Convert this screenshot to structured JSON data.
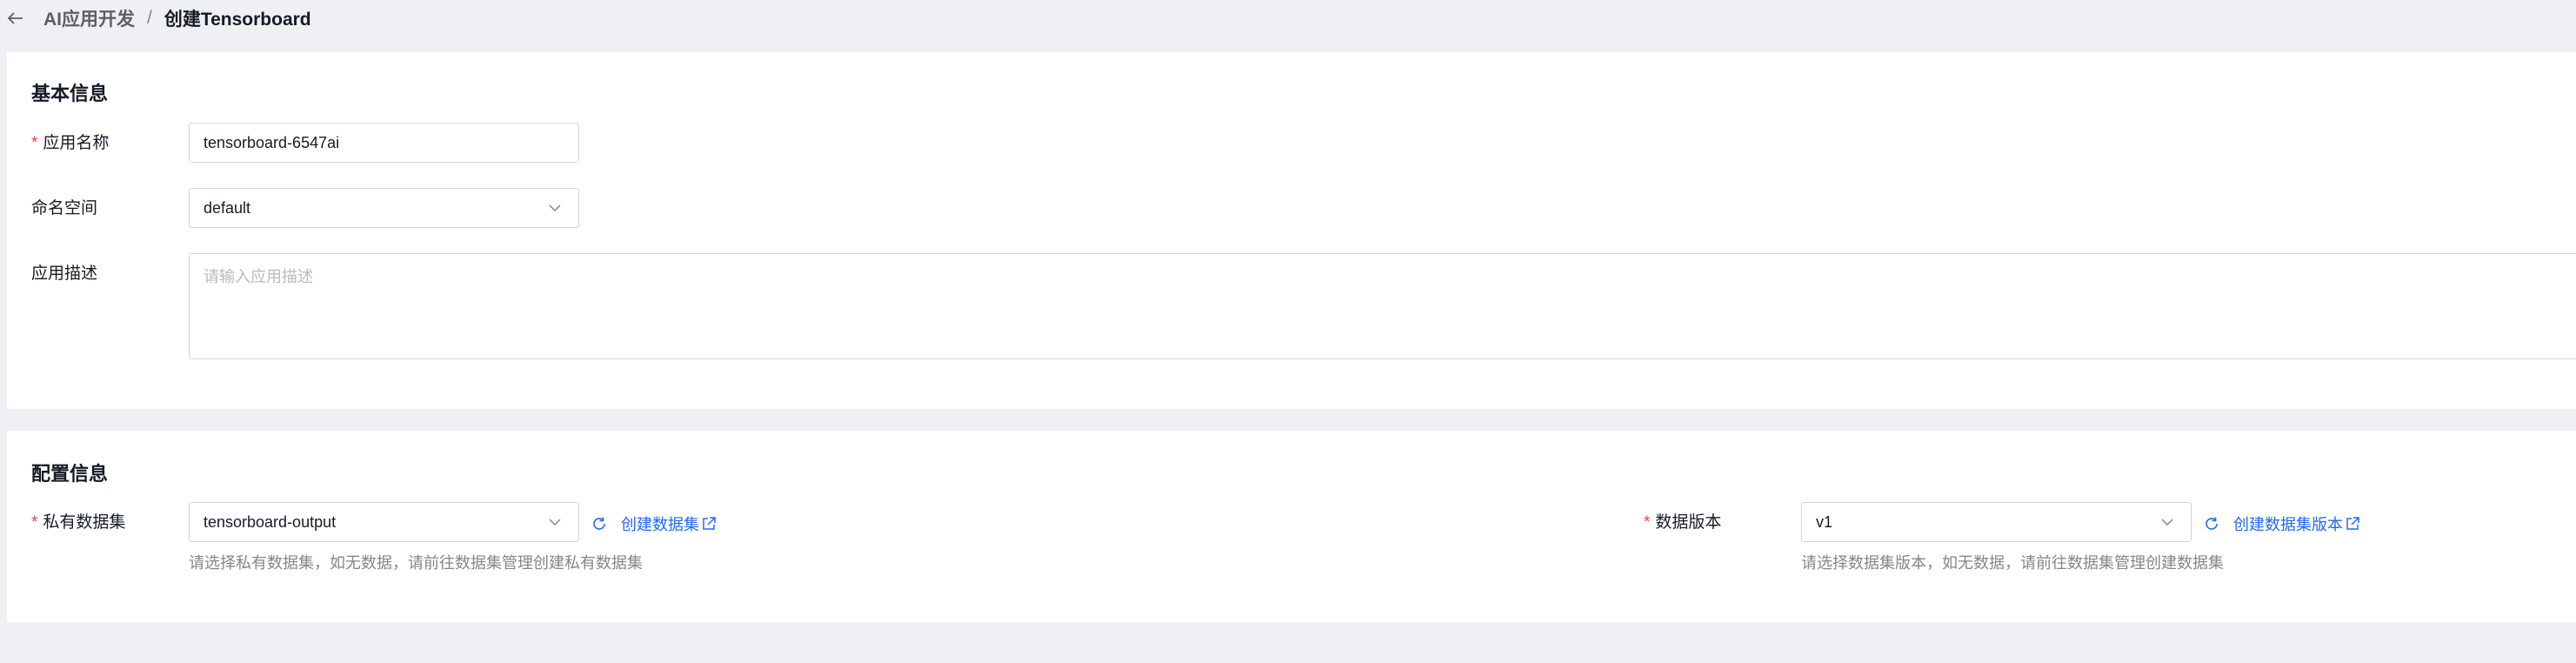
{
  "header": {
    "parent": "AI应用开发",
    "separator": "/",
    "current": "创建Tensorboard"
  },
  "basic": {
    "title": "基本信息",
    "app_name": {
      "required": "*",
      "label": "应用名称",
      "value": "tensorboard-6547ai"
    },
    "namespace": {
      "label": "命名空间",
      "value": "default"
    },
    "description": {
      "label": "应用描述",
      "placeholder": "请输入应用描述"
    }
  },
  "config": {
    "title": "配置信息",
    "dataset": {
      "required": "*",
      "label": "私有数据集",
      "value": "tensorboard-output",
      "link": "创建数据集",
      "hint": "请选择私有数据集，如无数据，请前往数据集管理创建私有数据集"
    },
    "version": {
      "required": "*",
      "label": "数据版本",
      "value": "v1",
      "link": "创建数据集版本",
      "hint": "请选择数据集版本，如无数据，请前往数据集管理创建数据集"
    }
  },
  "colors": {
    "accent": "#2468f2",
    "required": "#f33e3e",
    "background": "#eff0f4"
  }
}
